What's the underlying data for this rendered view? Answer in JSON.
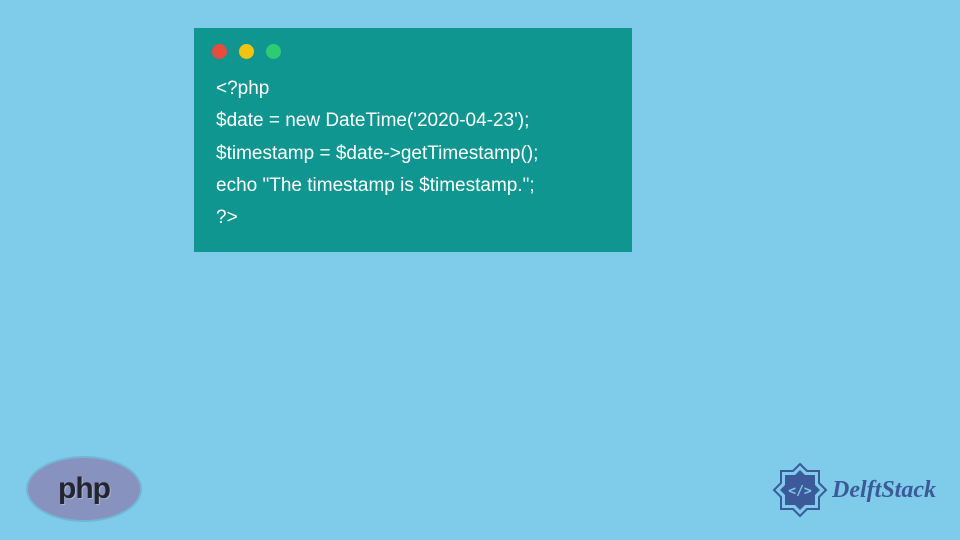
{
  "code": {
    "line1": "<?php",
    "line2": "$date = new DateTime('2020-04-23');",
    "line3": "$timestamp = $date->getTimestamp();",
    "line4": "echo \"The timestamp is $timestamp.\";",
    "line5": "?>"
  },
  "logos": {
    "php_text": "php",
    "delftstack_text": "DelftStack"
  }
}
